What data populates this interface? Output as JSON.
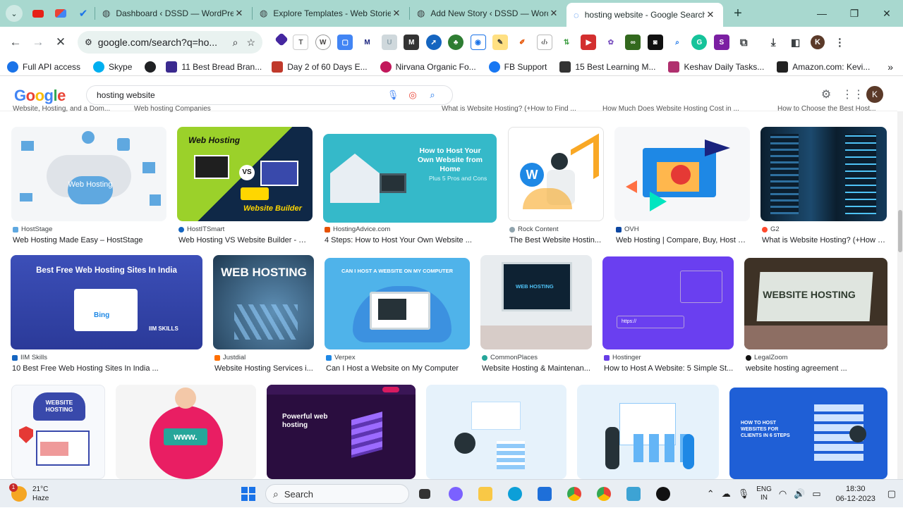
{
  "browser": {
    "pinned_tabs": [
      "youtube-favicon",
      "gmail-favicon",
      "tasks-favicon"
    ],
    "tabs": [
      {
        "title": "Dashboard ‹ DSSD — WordPress",
        "icon": "globe-icon"
      },
      {
        "title": "Explore Templates - Web Stories",
        "icon": "globe-icon"
      },
      {
        "title": "Add New Story ‹ DSSD — WordPress",
        "icon": "globe-icon"
      },
      {
        "title": "hosting website - Google Search",
        "icon": "globe-icon",
        "active": true
      }
    ],
    "new_tab": "+",
    "address": "google.com/search?q=ho...",
    "profile_initial": "K"
  },
  "bookmarks": [
    {
      "label": "Full API access",
      "color": "#1a73e8"
    },
    {
      "label": "Skype",
      "color": "#00aff0"
    },
    {
      "label": "",
      "color": "#202124"
    },
    {
      "label": "11 Best Bread Bran...",
      "color": "#3b2a8f"
    },
    {
      "label": "Day 2 of 60 Days E...",
      "color": "#c0392b"
    },
    {
      "label": "Nirvana Organic Fo...",
      "color": "#c2185b"
    },
    {
      "label": "FB Support",
      "color": "#1877f2"
    },
    {
      "label": "15 Best Learning M...",
      "color": "#333333"
    },
    {
      "label": "Keshav Daily Tasks...",
      "color": "#b0306e"
    },
    {
      "label": "Amazon.com: Kevi...",
      "color": "#222222"
    }
  ],
  "google": {
    "logo": "Google",
    "query": "hosting website",
    "profile_initial": "K"
  },
  "clipped_titles": [
    "Website, Hosting, and a Dom...",
    "Web hosting Companies",
    "What is Website Hosting? (+How to Find ...",
    "How Much Does Website Hosting Cost in ...",
    "How to Choose the Best Host..."
  ],
  "results_row1": [
    {
      "source": "HostStage",
      "title": "Web Hosting Made Easy – HostStage",
      "img_text": "Web Hosting"
    },
    {
      "source": "HostITSmart",
      "title": "Web Hosting VS Website Builder - Kn...",
      "img_text": "Web Hosting",
      "img_text2": "Website Builder",
      "img_text3": "VS"
    },
    {
      "source": "HostingAdvice.com",
      "title": "4 Steps: How to Host Your Own Website ...",
      "img_text": "How to Host Your Own Website from Home",
      "img_text2": "Plus 5 Pros and Cons"
    },
    {
      "source": "Rock Content",
      "title": "The Best Website Hostin..."
    },
    {
      "source": "OVH",
      "title": "Web Hosting | Compare, Buy, Host a ..."
    },
    {
      "source": "G2",
      "title": "What is Website Hosting? (+How t..."
    }
  ],
  "results_row2": [
    {
      "source": "IIM Skills",
      "title": "10 Best Free Web Hosting Sites In India ...",
      "img_text": "Best Free Web Hosting Sites In India",
      "img_text2": "IIM SKILLS",
      "img_text3": "Bing"
    },
    {
      "source": "Justdial",
      "title": "Website Hosting Services i...",
      "img_text": "WEB HOSTING"
    },
    {
      "source": "Verpex",
      "title": "Can I Host a Website on My Computer",
      "img_text": "CAN I HOST A WEBSITE ON MY COMPUTER"
    },
    {
      "source": "CommonPlaces",
      "title": "Website Hosting & Maintenan...",
      "img_text": "WEB HOSTING"
    },
    {
      "source": "Hostinger",
      "title": "How to Host A Website: 5 Simple St...",
      "img_text": "https://"
    },
    {
      "source": "LegalZoom",
      "title": "website hosting agreement ...",
      "img_text": "WEBSITE HOSTING"
    }
  ],
  "results_row3": [
    {
      "img_text": "WEBSITE HOSTING"
    },
    {
      "img_text": "www."
    },
    {
      "img_text": "Powerful web hosting"
    },
    {
      "img_text": ""
    },
    {
      "img_text": ""
    },
    {
      "img_text": "HOW TO HOST WEBSITES FOR CLIENTS IN 6 STEPS"
    }
  ],
  "taskbar": {
    "weather_temp": "21°C",
    "weather_desc": "Haze",
    "weather_badge": "1",
    "search_placeholder": "Search",
    "lang_top": "ENG",
    "lang_bottom": "IN",
    "time": "18:30",
    "date": "06-12-2023"
  }
}
